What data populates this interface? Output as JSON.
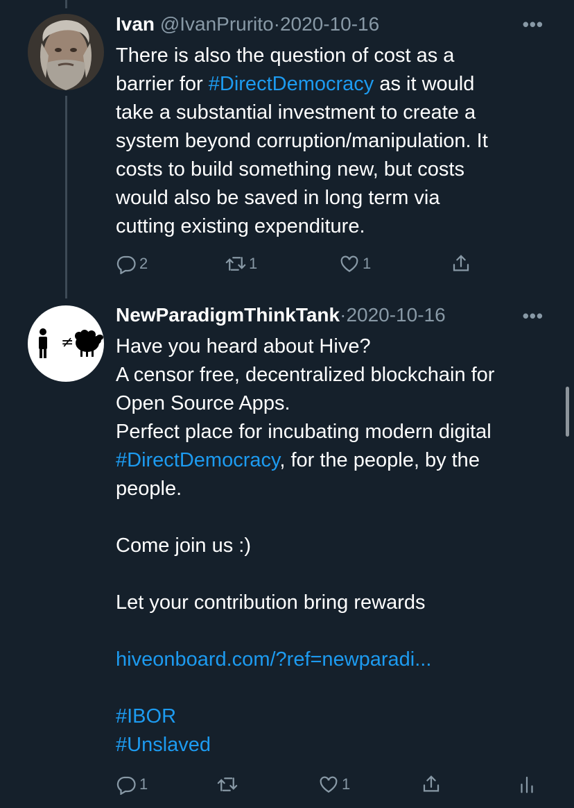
{
  "tweets": [
    {
      "display_name": "Ivan",
      "handle": "@IvanPrurito",
      "date": "2020-10-16",
      "more": "•••",
      "lines": [
        [
          {
            "t": "There is also the question of cost as a"
          }
        ],
        [
          {
            "t": "barrier for "
          },
          {
            "t": "#DirectDemocracy",
            "link": true
          },
          {
            "t": " as it would"
          }
        ],
        [
          {
            "t": "take a substantial investment to create a"
          }
        ],
        [
          {
            "t": "system beyond corruption/manipulation. It"
          }
        ],
        [
          {
            "t": "costs to build something new, but costs"
          }
        ],
        [
          {
            "t": "would also be saved in long term via"
          }
        ],
        [
          {
            "t": "cutting existing expenditure."
          }
        ]
      ],
      "actions": {
        "reply_count": "2",
        "retweet_count": "1",
        "like_count": "1"
      }
    },
    {
      "display_name": "NewParadigmThinkTank",
      "date": "2020-10-16",
      "more": "•••",
      "avatar_symbol": "≠",
      "lines": [
        [
          {
            "t": "Have you heard about Hive?"
          }
        ],
        [
          {
            "t": "A censor free, decentralized blockchain for"
          }
        ],
        [
          {
            "t": "Open Source Apps."
          }
        ],
        [
          {
            "t": "Perfect place for incubating modern digital"
          }
        ],
        [
          {
            "t": "#DirectDemocracy",
            "link": true
          },
          {
            "t": ", for the people, by the"
          }
        ],
        [
          {
            "t": "people."
          }
        ],
        [],
        [
          {
            "t": "Come join us :)"
          }
        ],
        [],
        [
          {
            "t": "Let your contribution bring rewards"
          }
        ],
        [],
        [
          {
            "t": "hiveonboard.com/?ref=newparadi...",
            "link": true
          }
        ],
        [],
        [
          {
            "t": "#IBOR",
            "link": true
          }
        ],
        [
          {
            "t": "#Unslaved",
            "link": true
          }
        ]
      ],
      "actions": {
        "reply_count": "1",
        "retweet_count": "",
        "like_count": "1"
      }
    }
  ],
  "icons": [
    "reply-icon",
    "retweet-icon",
    "like-icon",
    "share-icon",
    "analytics-icon",
    "more-icon"
  ],
  "colors": {
    "background": "#15202b",
    "link": "#1d9bf0",
    "muted": "#8899a6"
  }
}
